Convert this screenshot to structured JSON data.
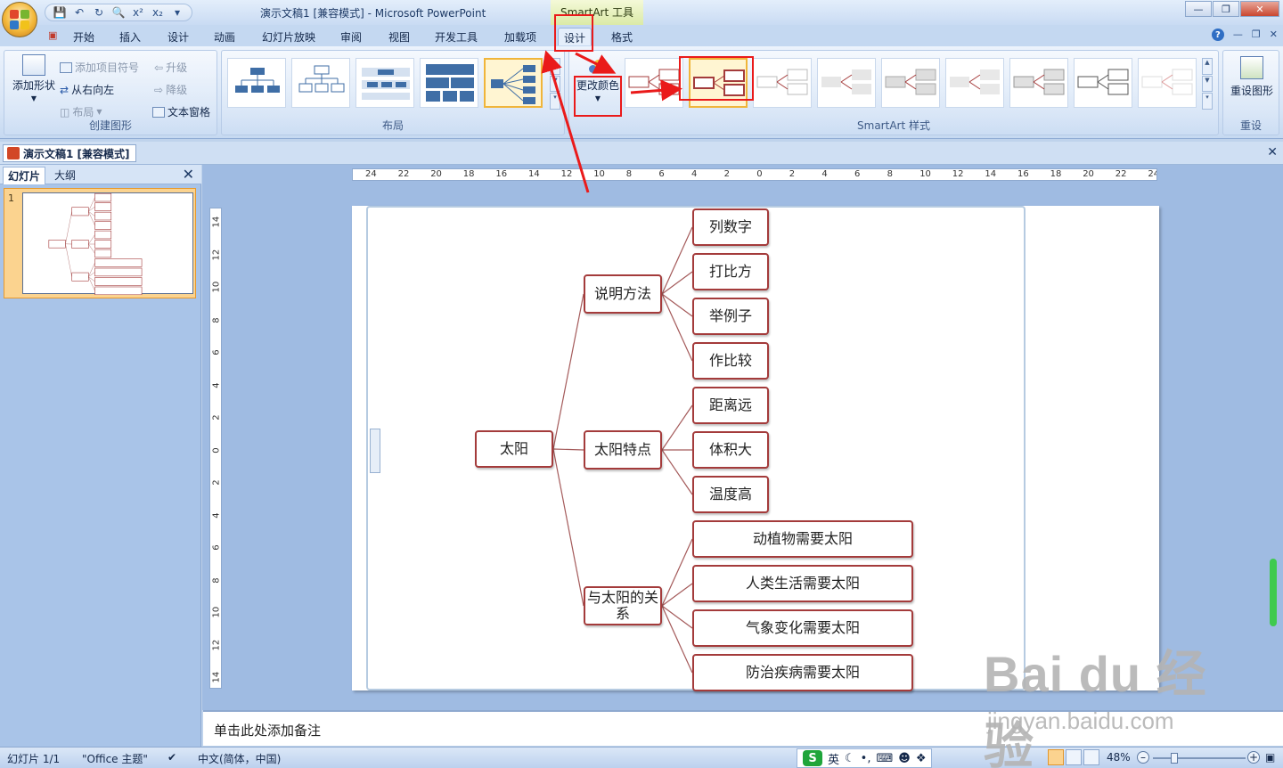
{
  "window": {
    "title": "演示文稿1 [兼容模式] - Microsoft PowerPoint",
    "context_title": "SmartArt 工具"
  },
  "tabs": [
    "开始",
    "插入",
    "设计",
    "动画",
    "幻灯片放映",
    "审阅",
    "视图",
    "开发工具",
    "加载项",
    "设计",
    "格式"
  ],
  "ribbon": {
    "create_group": {
      "label": "创建图形",
      "add_shape": "添加形状",
      "add_bullet": "添加项目符号",
      "right_to_left": "从右向左",
      "layout": "布局",
      "promote": "升级",
      "demote": "降级",
      "text_pane": "文本窗格"
    },
    "layout_group": {
      "label": "布局"
    },
    "styles_group": {
      "label": "SmartArt 样式",
      "change_colors": "更改颜色"
    },
    "reset_group": {
      "label": "重设",
      "reset_graphic": "重设图形"
    }
  },
  "doc_tab": {
    "title": "演示文稿1 [兼容模式]"
  },
  "left_pane": {
    "tab_slides": "幻灯片",
    "tab_outline": "大纲",
    "slide_number": "1"
  },
  "ruler": {
    "horizontal": [
      "24",
      "22",
      "20",
      "18",
      "16",
      "14",
      "12",
      "10",
      "8",
      "6",
      "4",
      "2",
      "0",
      "2",
      "4",
      "6",
      "8",
      "10",
      "12",
      "14",
      "16",
      "18",
      "20",
      "22",
      "24"
    ],
    "vertical": [
      "14",
      "12",
      "10",
      "8",
      "6",
      "4",
      "2",
      "0",
      "2",
      "4",
      "6",
      "8",
      "10",
      "12",
      "14"
    ]
  },
  "diagram": {
    "root": "太阳",
    "branches": [
      {
        "label": "说明方法",
        "children": [
          "列数字",
          "打比方",
          "举例子",
          "作比较"
        ]
      },
      {
        "label": "太阳特点",
        "children": [
          "距离远",
          "体积大",
          "温度高"
        ]
      },
      {
        "label": "与太阳的关系",
        "children": [
          "动植物需要太阳",
          "人类生活需要太阳",
          "气象变化需要太阳",
          "防治疾病需要太阳"
        ]
      }
    ],
    "colors": {
      "border": "#a43b3b",
      "connector": "#a45a5a"
    }
  },
  "notes": {
    "placeholder": "单击此处添加备注"
  },
  "status": {
    "slide": "幻灯片 1/1",
    "theme": "\"Office 主题\"",
    "language": "中文(简体，中国)",
    "ime": "英",
    "zoom": "48%"
  },
  "watermark": {
    "brand": "Bai du 经验",
    "url": "jingyan.baidu.com"
  },
  "accent_colors": {
    "annotation": "#ea1a1a",
    "selected": "#f0b53a",
    "ribbon": "#d6e4f6"
  }
}
